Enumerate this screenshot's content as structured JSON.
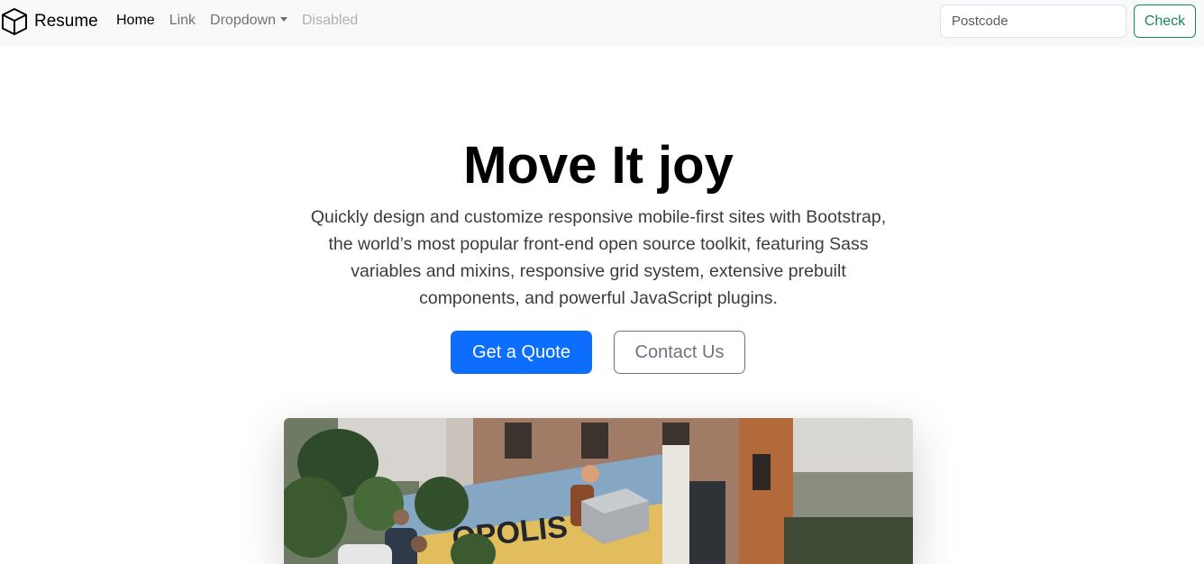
{
  "navbar": {
    "brand": {
      "icon": "box-icon",
      "text": "Resume"
    },
    "links": [
      {
        "label": "Home",
        "state": "active"
      },
      {
        "label": "Link",
        "state": "normal"
      },
      {
        "label": "Dropdown",
        "state": "normal",
        "has_caret": true
      },
      {
        "label": "Disabled",
        "state": "disabled"
      }
    ],
    "search": {
      "placeholder": "Postcode",
      "value": ""
    },
    "check_label": "Check"
  },
  "hero": {
    "title": "Move It joy",
    "lead": "Quickly design and customize responsive mobile-first sites with Bootstrap, the world’s most popular front-end open source toolkit, featuring Sass variables and mixins, responsive grid system, extensive prebuilt components, and powerful JavaScript plugins.",
    "primary_button": "Get a Quote",
    "secondary_button": "Contact Us",
    "image_text": "OPOLIS"
  },
  "colors": {
    "navbar_bg": "#f8f9fa",
    "primary": "#0d6efd",
    "success": "#198754",
    "secondary": "#6c757d"
  }
}
